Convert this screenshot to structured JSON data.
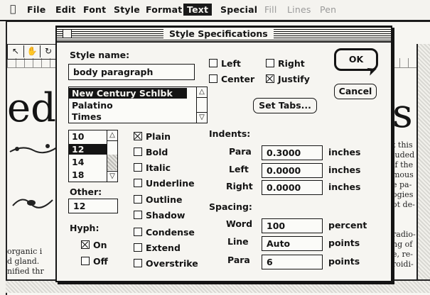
{
  "menubar": {
    "items": [
      {
        "label": "File",
        "state": "normal"
      },
      {
        "label": "Edit",
        "state": "normal"
      },
      {
        "label": "Font",
        "state": "normal"
      },
      {
        "label": "Style",
        "state": "normal"
      },
      {
        "label": "Format",
        "state": "normal"
      },
      {
        "label": "Text",
        "state": "selected"
      },
      {
        "label": "Special",
        "state": "normal"
      },
      {
        "label": "Fill",
        "state": "dimmed"
      },
      {
        "label": "Lines",
        "state": "dimmed"
      },
      {
        "label": "Pen",
        "state": "dimmed"
      }
    ]
  },
  "background": {
    "big_left": "ed",
    "big_right": "s",
    "right_text": [
      "t this",
      "luded",
      "if the",
      "mous",
      "e pa-",
      "ogies",
      "ot de-",
      "",
      "radio-",
      "ng of",
      "e, re-",
      "roidi-"
    ],
    "left_text": [
      "organic i",
      "d gland.",
      "nified thr"
    ]
  },
  "dialog": {
    "title": "Style Specifications",
    "style_name_label": "Style name:",
    "style_name_value": "body paragraph",
    "font_list": [
      "New Century Schlbk",
      "Palatino",
      "Times"
    ],
    "font_selected": 0,
    "size_list": [
      "10",
      "12",
      "14",
      "18"
    ],
    "size_selected": 1,
    "other_label": "Other:",
    "other_value": "12",
    "hyph_label": "Hyph:",
    "hyph_options": [
      {
        "label": "On",
        "on": true
      },
      {
        "label": "Off",
        "on": false
      }
    ],
    "alignment": [
      {
        "label": "Left",
        "checked": false
      },
      {
        "label": "Right",
        "checked": false
      },
      {
        "label": "Center",
        "checked": false
      },
      {
        "label": "Justify",
        "checked": true
      }
    ],
    "ok_label": "OK",
    "cancel_label": "Cancel",
    "set_tabs_label": "Set Tabs...",
    "styles": [
      {
        "label": "Plain",
        "checked": true
      },
      {
        "label": "Bold",
        "checked": false
      },
      {
        "label": "Italic",
        "checked": false
      },
      {
        "label": "Underline",
        "checked": false
      },
      {
        "label": "Outline",
        "checked": false
      },
      {
        "label": "Shadow",
        "checked": false
      },
      {
        "label": "Condense",
        "checked": false
      },
      {
        "label": "Extend",
        "checked": false
      },
      {
        "label": "Overstrike",
        "checked": false
      }
    ],
    "indents_label": "Indents:",
    "indents": [
      {
        "label": "Para",
        "value": "0.3000",
        "unit": "inches"
      },
      {
        "label": "Left",
        "value": "0.0000",
        "unit": "inches"
      },
      {
        "label": "Right",
        "value": "0.0000",
        "unit": "inches"
      }
    ],
    "spacing_label": "Spacing:",
    "spacing": [
      {
        "label": "Word",
        "value": "100",
        "unit": "percent"
      },
      {
        "label": "Line",
        "value": "Auto",
        "unit": "points"
      },
      {
        "label": "Para",
        "value": "6",
        "unit": "points"
      }
    ]
  }
}
